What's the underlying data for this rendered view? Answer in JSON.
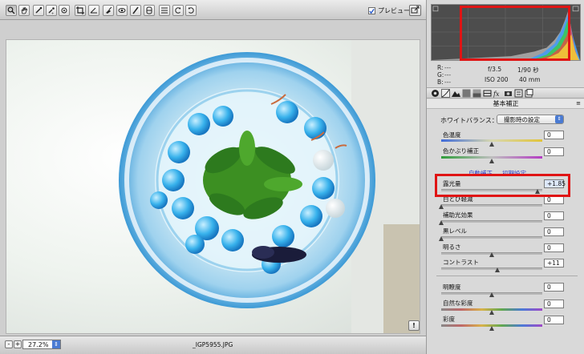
{
  "toolbar": {
    "tools": [
      "zoom-tool",
      "hand-tool",
      "white-balance-tool",
      "color-sampler-tool",
      "target-adjustment-tool",
      "crop-tool",
      "straighten-tool",
      "spot-removal-tool",
      "red-eye-tool",
      "adjustment-brush-tool",
      "graduated-filter-tool",
      "preferences-tool",
      "rotate-ccw-tool",
      "rotate-cw-tool"
    ],
    "preview_label": "プレビュー",
    "preview_checked": true
  },
  "status": {
    "zoom_minus": "-",
    "zoom_plus": "+",
    "zoom_value": "27.2%",
    "filename": "_IGP5955.JPG",
    "warning": "!"
  },
  "info": {
    "r_label": "R:",
    "g_label": "G:",
    "b_label": "B:",
    "r_value": "---",
    "g_value": "---",
    "b_value": "---",
    "aperture": "f/3.5",
    "shutter": "1/90 秒",
    "iso": "ISO 200",
    "focal": "40 mm"
  },
  "panel": {
    "section_title": "基本補正",
    "white_balance_label": "ホワイトバランス：",
    "white_balance_value": "撮影時の設定",
    "auto_link": "自動補正",
    "default_link": "初期設定",
    "sliders": {
      "temperature": {
        "label": "色温度",
        "value": "0",
        "pos": 0.5
      },
      "tint": {
        "label": "色かぶり補正",
        "value": "0",
        "pos": 0.5
      },
      "exposure": {
        "label": "露光量",
        "value": "+1.85",
        "pos": 0.96
      },
      "recovery": {
        "label": "白とび軽減",
        "value": "0",
        "pos": 0.0
      },
      "fill": {
        "label": "補助光効果",
        "value": "0",
        "pos": 0.0
      },
      "blacks": {
        "label": "黒レベル",
        "value": "0",
        "pos": 0.0
      },
      "brightness": {
        "label": "明るさ",
        "value": "0",
        "pos": 0.5
      },
      "contrast": {
        "label": "コントラスト",
        "value": "+11",
        "pos": 0.56
      },
      "clarity": {
        "label": "明瞭度",
        "value": "0",
        "pos": 0.5
      },
      "vibrance": {
        "label": "自然な彩度",
        "value": "0",
        "pos": 0.5
      },
      "saturation": {
        "label": "彩度",
        "value": "0",
        "pos": 0.5
      }
    }
  },
  "colors": {
    "highlight": "#e01414",
    "accent": "#4a7bd3",
    "link": "#2a3cc6"
  }
}
